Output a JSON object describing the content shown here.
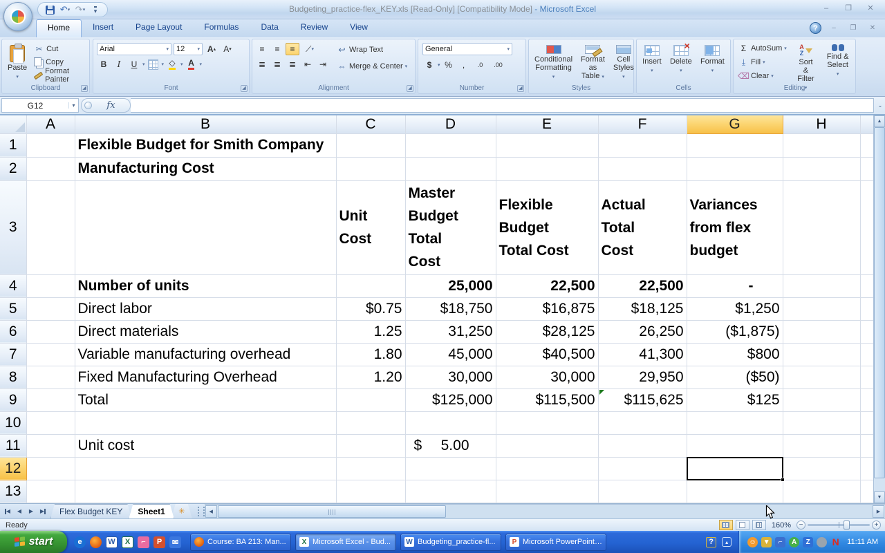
{
  "window": {
    "title_file": "Budgeting_practice-flex_KEY.xls  [Read-Only]  [Compatibility Mode]",
    "title_app": "- Microsoft Excel",
    "minimize": "–",
    "restore": "❐",
    "close": "✕",
    "help": "?"
  },
  "ribbon": {
    "tabs": [
      "Home",
      "Insert",
      "Page Layout",
      "Formulas",
      "Data",
      "Review",
      "View"
    ],
    "active_tab": "Home",
    "clipboard": {
      "label": "Clipboard",
      "paste": "Paste",
      "cut": "Cut",
      "copy": "Copy",
      "format_painter": "Format Painter"
    },
    "font": {
      "label": "Font",
      "font_name": "Arial",
      "font_size": "12",
      "bold": "B",
      "italic": "I",
      "underline": "U"
    },
    "alignment": {
      "label": "Alignment",
      "wrap_text": "Wrap Text",
      "merge_center": "Merge & Center"
    },
    "number": {
      "label": "Number",
      "format": "General",
      "currency": "$",
      "percent": "%",
      "comma": ",",
      "inc_dec": ".0",
      "dec_dec": ".00"
    },
    "styles": {
      "label": "Styles",
      "cf1": "Conditional",
      "cf2": "Formatting",
      "ft1": "Format",
      "ft2": "as Table",
      "cs1": "Cell",
      "cs2": "Styles"
    },
    "cells": {
      "label": "Cells",
      "insert": "Insert",
      "delete": "Delete",
      "format": "Format"
    },
    "editing": {
      "label": "Editing",
      "autosum": "AutoSum",
      "autosum_sigma": "Σ",
      "fill": "Fill",
      "clear": "Clear",
      "sort1": "Sort &",
      "sort2": "Filter",
      "find1": "Find &",
      "find2": "Select"
    }
  },
  "formula_bar": {
    "name_box": "G12",
    "fx": "fx",
    "formula": ""
  },
  "sheet": {
    "selected_cell": "G12",
    "col_headers": [
      "A",
      "B",
      "C",
      "D",
      "E",
      "F",
      "G",
      "H"
    ],
    "selected_col": "G",
    "row_headers": [
      "1",
      "2",
      "3",
      "4",
      "5",
      "6",
      "7",
      "8",
      "9",
      "10",
      "11",
      "12",
      "13"
    ],
    "selected_row": "12",
    "cells": {
      "b1": "Flexible Budget for Smith Company",
      "b2": "Manufacturing Cost",
      "c3": [
        "Unit",
        "Cost"
      ],
      "d3": [
        "Master",
        "Budget",
        "Total",
        "Cost"
      ],
      "e3": [
        "Flexible",
        "Budget",
        "Total Cost"
      ],
      "f3": [
        "Actual",
        "Total",
        "Cost"
      ],
      "g3": [
        "Variances",
        "from flex",
        "budget"
      ],
      "r4": {
        "b": "Number of units",
        "d": "25,000",
        "e": "22,500",
        "f": "22,500",
        "g": "-"
      },
      "r5": {
        "b": "Direct labor",
        "c": "$0.75",
        "d": "$18,750",
        "e": "$16,875",
        "f": "$18,125",
        "g": "$1,250"
      },
      "r6": {
        "b": "Direct materials",
        "c": "1.25",
        "d": "31,250",
        "e": "$28,125",
        "f": "26,250",
        "g": "($1,875)"
      },
      "r7": {
        "b": "Variable manufacturing overhead",
        "c": "1.80",
        "d": "45,000",
        "e": "$40,500",
        "f": "41,300",
        "g": "$800"
      },
      "r8": {
        "b": "Fixed Manufacturing Overhead",
        "c": "1.20",
        "d": "30,000",
        "e": "30,000",
        "f": "29,950",
        "g": "($50)"
      },
      "r9": {
        "b": "Total",
        "d": "$125,000",
        "e": "$115,500",
        "f": "$115,625",
        "g": "$125"
      },
      "r11": {
        "b": "Unit cost",
        "d_currency": "$",
        "d_value": "5.00"
      }
    }
  },
  "sheet_tabs": {
    "tabs": [
      "Flex Budget KEY",
      "Sheet1"
    ],
    "active": "Sheet1"
  },
  "status": {
    "ready": "Ready",
    "zoom": "160%"
  },
  "taskbar": {
    "start": "start",
    "buttons": [
      {
        "label": "Course: BA 213: Man...",
        "icon": "firefox"
      },
      {
        "label": "Microsoft Excel - Bud...",
        "icon": "excel",
        "active": true
      },
      {
        "label": "Budgeting_practice-fl...",
        "icon": "word"
      },
      {
        "label": "Microsoft PowerPoint ...",
        "icon": "powerpoint"
      }
    ],
    "clock": "11:11 AM"
  },
  "colors": {
    "selection_header": "#F7C149",
    "negative_value": "#FF0000",
    "taskbar_blue": "#2463D2",
    "start_green": "#359231",
    "title_app_blue": "#4A7EBB"
  }
}
